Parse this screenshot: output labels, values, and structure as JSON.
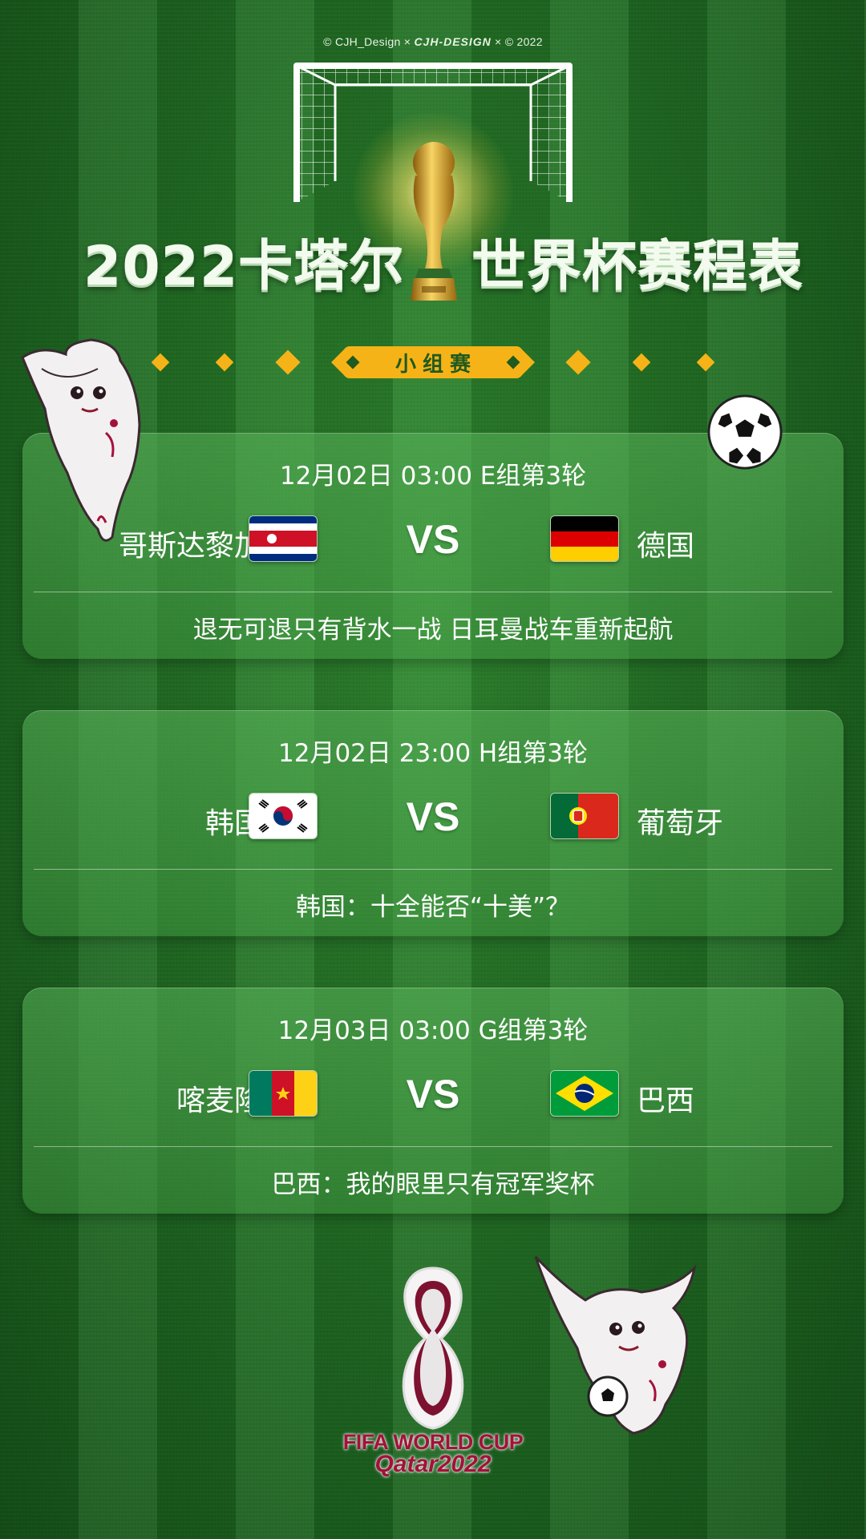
{
  "credit": {
    "left": "© CJH_Design",
    "sep1": "×",
    "brand": "CJH-DESIGN",
    "sep2": "×",
    "year": "© 2022"
  },
  "title": {
    "left": "2022卡塔尔",
    "right": "世界杯赛程表"
  },
  "stage": {
    "label": "小组赛"
  },
  "matches": [
    {
      "when": "12月02日 03:00 E组第3轮",
      "home": "哥斯达黎加",
      "home_flag": "costa-rica-flag-icon",
      "away": "德国",
      "away_flag": "germany-flag-icon",
      "vs": "VS",
      "slogan": "退无可退只有背水一战 日耳曼战车重新起航"
    },
    {
      "when": "12月02日 23:00 H组第3轮",
      "home": "韩国",
      "home_flag": "korea-flag-icon",
      "away": "葡萄牙",
      "away_flag": "portugal-flag-icon",
      "vs": "VS",
      "slogan": "韩国：十全能否“十美”？"
    },
    {
      "when": "12月03日 03:00 G组第3轮",
      "home": "喀麦隆",
      "home_flag": "cameroon-flag-icon",
      "away": "巴西",
      "away_flag": "brazil-flag-icon",
      "vs": "VS",
      "slogan": "巴西：我的眼里只有冠军奖杯"
    }
  ],
  "footer": {
    "line1": "FIFA WORLD CUP",
    "line2": "Qatar2022"
  },
  "colors": {
    "accent": "#f6b317",
    "brand_maroon": "#a3113a",
    "grass": "#1f6b22"
  }
}
